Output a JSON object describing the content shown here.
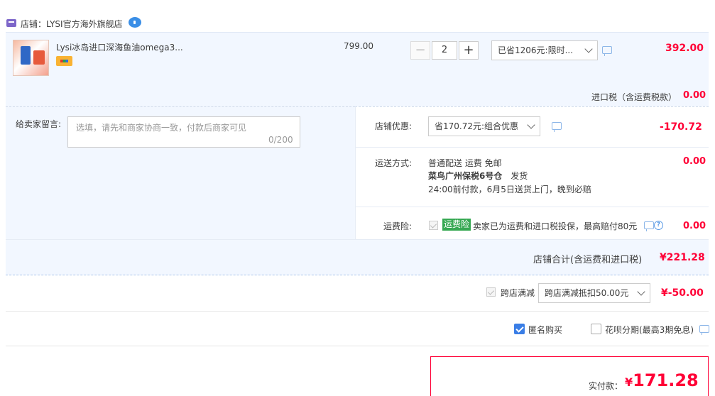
{
  "store": {
    "name": "店铺：LYSI官方海外旗舰店"
  },
  "item": {
    "title": "Lysi冰岛进口深海鱼油omega3...",
    "unit_price": "799.00",
    "quantity": "2",
    "minus_label": "−",
    "plus_label": "+",
    "promo_selected": "已省1206元:限时...",
    "subtotal": "392.00"
  },
  "tax": {
    "label": "进口税（含运费税款）",
    "value": "0.00"
  },
  "message": {
    "label": "给卖家留言:",
    "placeholder": "选填，请先和商家协商一致，付款后商家可见",
    "counter": "0/200"
  },
  "shop_promo": {
    "label": "店铺优惠:",
    "selected": "省170.72元:组合优惠",
    "value": "-170.72"
  },
  "shipping": {
    "label": "运送方式:",
    "line1": "普通配送 运费 免邮",
    "warehouse": "菜鸟广州保税6号仓",
    "ship_text": "发货",
    "line3": "24:00前付款，6月5日送货上门，晚到必赔",
    "value": "0.00"
  },
  "insurance": {
    "label": "运费险:",
    "badge": "运费险",
    "text": "卖家已为运费和进口税投保，最高赔付80元",
    "help": "?",
    "value": "0.00"
  },
  "shop_total": {
    "label": "店铺合计(含运费和进口税)",
    "value": "¥221.28"
  },
  "cross_store": {
    "label": "跨店满减",
    "selected": "跨店满减抵扣50.00元",
    "value": "¥-50.00"
  },
  "options": {
    "anonymous_label": "匿名购买",
    "huabei_label": "花呗分期(最高3期免息)"
  },
  "payment": {
    "label": "实付款：",
    "currency": "¥",
    "amount": "171.28"
  },
  "colors": {
    "accent_red": "#ff0036",
    "panel_blue": "#f2f7ff",
    "checkbox_blue": "#3a7ee6",
    "insurance_green": "#36a852"
  }
}
